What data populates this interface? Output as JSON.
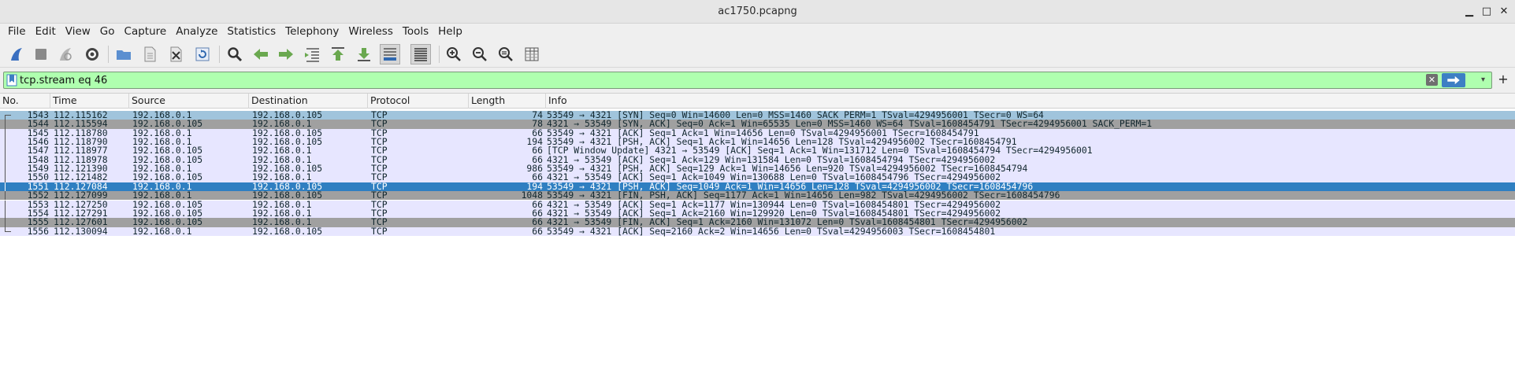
{
  "window": {
    "title": "ac1750.pcapng"
  },
  "menu": [
    "File",
    "Edit",
    "View",
    "Go",
    "Capture",
    "Analyze",
    "Statistics",
    "Telephony",
    "Wireless",
    "Tools",
    "Help"
  ],
  "filter": {
    "value": "tcp.stream eq 46"
  },
  "columns": [
    "No.",
    "Time",
    "Source",
    "Destination",
    "Protocol",
    "Length",
    "Info"
  ],
  "colors": {
    "syn_bg": "#a0c4dc",
    "gray_bg": "#a0a0a0",
    "tcp_bg": "#e7e6ff",
    "selected_bg": "#2f7fc1",
    "filter_bg": "#afffaf"
  },
  "packets": [
    {
      "no": "1543",
      "time": "112.115162",
      "src": "192.168.0.1",
      "dst": "192.168.0.105",
      "proto": "TCP",
      "len": "74",
      "info": "53549 → 4321 [SYN] Seq=0 Win=14600 Len=0 MSS=1460 SACK_PERM=1 TSval=4294956001 TSecr=0 WS=64",
      "style": "syn"
    },
    {
      "no": "1544",
      "time": "112.115594",
      "src": "192.168.0.105",
      "dst": "192.168.0.1",
      "proto": "TCP",
      "len": "78",
      "info": "4321 → 53549 [SYN, ACK] Seq=0 Ack=1 Win=65535 Len=0 MSS=1460 WS=64 TSval=1608454791 TSecr=4294956001 SACK_PERM=1",
      "style": "gray"
    },
    {
      "no": "1545",
      "time": "112.118780",
      "src": "192.168.0.1",
      "dst": "192.168.0.105",
      "proto": "TCP",
      "len": "66",
      "info": "53549 → 4321 [ACK] Seq=1 Ack=1 Win=14656 Len=0 TSval=4294956001 TSecr=1608454791",
      "style": "tcp"
    },
    {
      "no": "1546",
      "time": "112.118790",
      "src": "192.168.0.1",
      "dst": "192.168.0.105",
      "proto": "TCP",
      "len": "194",
      "info": "53549 → 4321 [PSH, ACK] Seq=1 Ack=1 Win=14656 Len=128 TSval=4294956002 TSecr=1608454791",
      "style": "tcp"
    },
    {
      "no": "1547",
      "time": "112.118977",
      "src": "192.168.0.105",
      "dst": "192.168.0.1",
      "proto": "TCP",
      "len": "66",
      "info": "[TCP Window Update] 4321 → 53549 [ACK] Seq=1 Ack=1 Win=131712 Len=0 TSval=1608454794 TSecr=4294956001",
      "style": "tcp"
    },
    {
      "no": "1548",
      "time": "112.118978",
      "src": "192.168.0.105",
      "dst": "192.168.0.1",
      "proto": "TCP",
      "len": "66",
      "info": "4321 → 53549 [ACK] Seq=1 Ack=129 Win=131584 Len=0 TSval=1608454794 TSecr=4294956002",
      "style": "tcp"
    },
    {
      "no": "1549",
      "time": "112.121390",
      "src": "192.168.0.1",
      "dst": "192.168.0.105",
      "proto": "TCP",
      "len": "986",
      "info": "53549 → 4321 [PSH, ACK] Seq=129 Ack=1 Win=14656 Len=920 TSval=4294956002 TSecr=1608454794",
      "style": "tcp"
    },
    {
      "no": "1550",
      "time": "112.121482",
      "src": "192.168.0.105",
      "dst": "192.168.0.1",
      "proto": "TCP",
      "len": "66",
      "info": "4321 → 53549 [ACK] Seq=1 Ack=1049 Win=130688 Len=0 TSval=1608454796 TSecr=4294956002",
      "style": "tcp"
    },
    {
      "no": "1551",
      "time": "112.127084",
      "src": "192.168.0.1",
      "dst": "192.168.0.105",
      "proto": "TCP",
      "len": "194",
      "info": "53549 → 4321 [PSH, ACK] Seq=1049 Ack=1 Win=14656 Len=128 TSval=4294956002 TSecr=1608454796",
      "style": "selected"
    },
    {
      "no": "1552",
      "time": "112.127099",
      "src": "192.168.0.1",
      "dst": "192.168.0.105",
      "proto": "TCP",
      "len": "1048",
      "info": "53549 → 4321 [FIN, PSH, ACK] Seq=1177 Ack=1 Win=14656 Len=982 TSval=4294956002 TSecr=1608454796",
      "style": "gray"
    },
    {
      "no": "1553",
      "time": "112.127250",
      "src": "192.168.0.105",
      "dst": "192.168.0.1",
      "proto": "TCP",
      "len": "66",
      "info": "4321 → 53549 [ACK] Seq=1 Ack=1177 Win=130944 Len=0 TSval=1608454801 TSecr=4294956002",
      "style": "tcp"
    },
    {
      "no": "1554",
      "time": "112.127291",
      "src": "192.168.0.105",
      "dst": "192.168.0.1",
      "proto": "TCP",
      "len": "66",
      "info": "4321 → 53549 [ACK] Seq=1 Ack=2160 Win=129920 Len=0 TSval=1608454801 TSecr=4294956002",
      "style": "tcp"
    },
    {
      "no": "1555",
      "time": "112.127601",
      "src": "192.168.0.105",
      "dst": "192.168.0.1",
      "proto": "TCP",
      "len": "66",
      "info": "4321 → 53549 [FIN, ACK] Seq=1 Ack=2160 Win=131072 Len=0 TSval=1608454801 TSecr=4294956002",
      "style": "gray"
    },
    {
      "no": "1556",
      "time": "112.130094",
      "src": "192.168.0.1",
      "dst": "192.168.0.105",
      "proto": "TCP",
      "len": "66",
      "info": "53549 → 4321 [ACK] Seq=2160 Ack=2 Win=14656 Len=0 TSval=4294956003 TSecr=1608454801",
      "style": "tcp"
    }
  ]
}
